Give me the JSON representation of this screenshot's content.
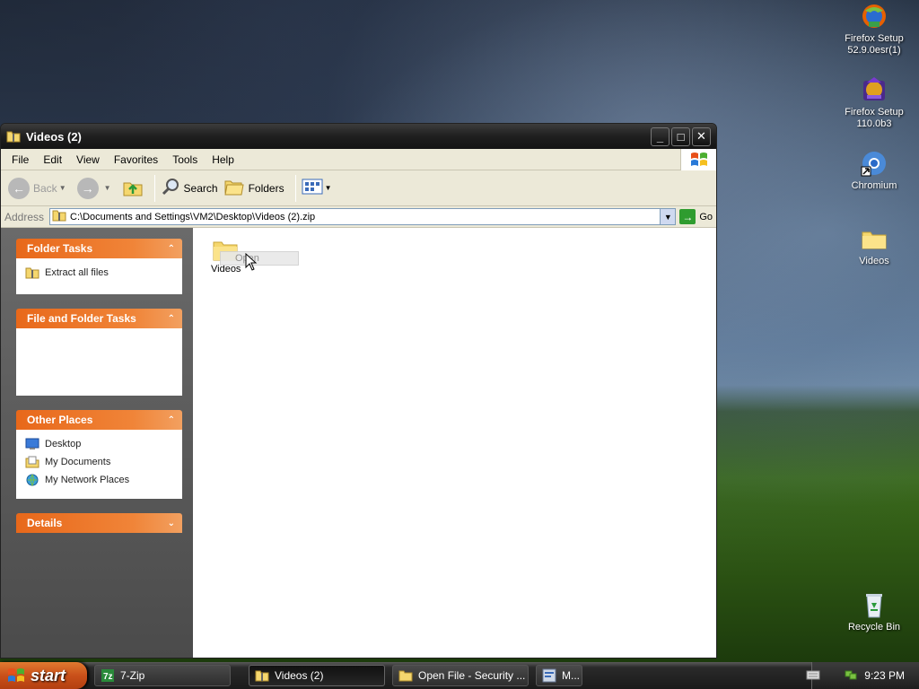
{
  "desktop": {
    "icons": [
      {
        "label": "Firefox Setup 52.9.0esr(1)",
        "icon": "firefox-setup-icon"
      },
      {
        "label": "Firefox Setup 110.0b3",
        "icon": "firefox-nightly-setup-icon"
      },
      {
        "label": "Chromium",
        "icon": "chromium-shortcut-icon"
      },
      {
        "label": "Videos",
        "icon": "folder-icon"
      },
      {
        "label": "Recycle Bin",
        "icon": "recycle-bin-icon"
      }
    ]
  },
  "window": {
    "title": "Videos (2)",
    "menu": [
      "File",
      "Edit",
      "View",
      "Favorites",
      "Tools",
      "Help"
    ],
    "toolbar": {
      "back": "Back",
      "search": "Search",
      "folders": "Folders"
    },
    "address": {
      "label": "Address",
      "value": "C:\\Documents and Settings\\VM2\\Desktop\\Videos (2).zip",
      "go": "Go"
    },
    "taskpane": {
      "folder_tasks": {
        "title": "Folder Tasks",
        "items": [
          "Extract all files"
        ]
      },
      "file_folder_tasks": {
        "title": "File and Folder Tasks"
      },
      "other_places": {
        "title": "Other Places",
        "items": [
          "Desktop",
          "My Documents",
          "My Network Places"
        ]
      },
      "details": {
        "title": "Details"
      }
    },
    "files": [
      {
        "label": "Videos",
        "icon": "folder-icon"
      }
    ],
    "drag_ghost": "Open"
  },
  "taskbar": {
    "start": "start",
    "tasks": [
      "7-Zip",
      "Videos (2)",
      "Open File - Security ...",
      "M..."
    ],
    "active_task": "Videos (2)",
    "clock": "9:23 PM"
  },
  "colors": {
    "taskpane_header": "#e8681a",
    "start_button": "#c9501a",
    "title_bar": "#1f1f1f"
  }
}
